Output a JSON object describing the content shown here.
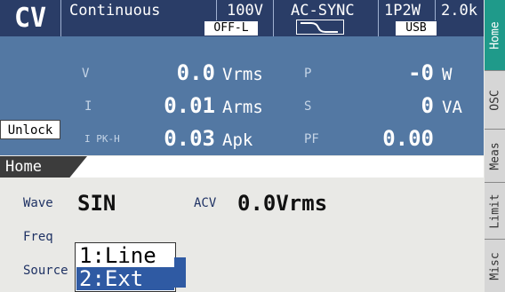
{
  "status_bar": {
    "mode": "CV",
    "output_mode": "Continuous",
    "voltage_range": "100V",
    "sync": "AC-SYNC",
    "wiring": "1P2W",
    "freq_range": "2.0k",
    "output_state": "OFF-L",
    "interface": "USB"
  },
  "measurements": {
    "left": [
      {
        "label": "V",
        "value": "0.0",
        "unit": "Vrms"
      },
      {
        "label": "I",
        "value": "0.01",
        "unit": "Arms"
      },
      {
        "label": "I PK-H",
        "value": "0.03",
        "unit": "Apk"
      }
    ],
    "right": [
      {
        "label": "P",
        "value": "-0",
        "unit": "W"
      },
      {
        "label": "S",
        "value": "0",
        "unit": "VA"
      },
      {
        "label": "PF",
        "value": "0.00",
        "unit": ""
      }
    ],
    "unlock_label": "Unlock"
  },
  "home": {
    "title": "Home",
    "wave_label": "Wave",
    "wave_value": "SIN",
    "acv_label": "ACV",
    "acv_value": "0.0Vrms",
    "freq_label": "Freq",
    "source_label": "Source"
  },
  "popup": {
    "options": [
      "1:Line",
      "2:Ext"
    ],
    "selected": "2:Ext"
  },
  "side_tabs": [
    "Home",
    "OSC",
    "Meas",
    "Limit",
    "Misc"
  ],
  "colors": {
    "status_bar_bg": "#2a3d67",
    "measure_bg": "#5378a3",
    "active_tab": "#1f9a8a",
    "selection": "#2f5aa3"
  }
}
